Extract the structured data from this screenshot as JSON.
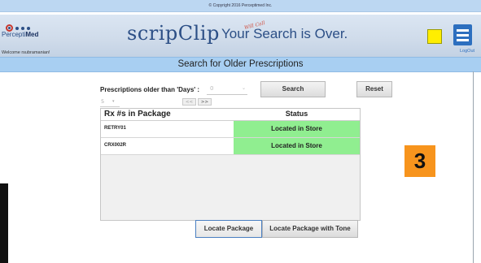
{
  "copyright": "© Copyright 2016 Perceptimed Inc.",
  "header": {
    "logo_prefix": "Percepti",
    "logo_suffix": "Med",
    "welcome": "Welcome rsubramanian!",
    "brand": "scripClip",
    "tagline": "Your Search is Over.",
    "tagline_stamp": "Will Call",
    "logout": "LogOut"
  },
  "title": "Search for Older Prescriptions",
  "search_form": {
    "days_label": "Prescriptions older than 'Days' :",
    "days_value": "0",
    "search_label": "Search",
    "reset_label": "Reset",
    "page_size": "5",
    "prev_label": "<<",
    "next_label": ">>"
  },
  "grid": {
    "col_rx": "Rx #s in Package",
    "col_status": "Status",
    "rows": [
      {
        "rx": "RETRY01",
        "status": "Located in Store"
      },
      {
        "rx": "CRX002R",
        "status": "Located in Store"
      }
    ],
    "status_color": "#90ee90"
  },
  "actions": {
    "locate_label": "Locate Package",
    "locate_tone_label": "Locate Package with Tone"
  },
  "step_badge": "3",
  "colors": {
    "title_bar": "#a8cff2",
    "menu_button": "#2d6fbf",
    "badge": "#f7941d",
    "indicator": "#ffee00"
  }
}
